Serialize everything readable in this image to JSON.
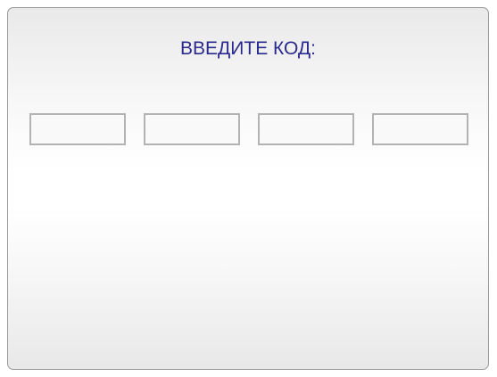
{
  "dialog": {
    "title": "ВВЕДИТЕ КОД:",
    "code_fields": [
      {
        "value": ""
      },
      {
        "value": ""
      },
      {
        "value": ""
      },
      {
        "value": ""
      }
    ]
  },
  "colors": {
    "title_text": "#2b2a8f",
    "field_border": "#b3b3b3",
    "panel_border": "#9a9a9a"
  }
}
